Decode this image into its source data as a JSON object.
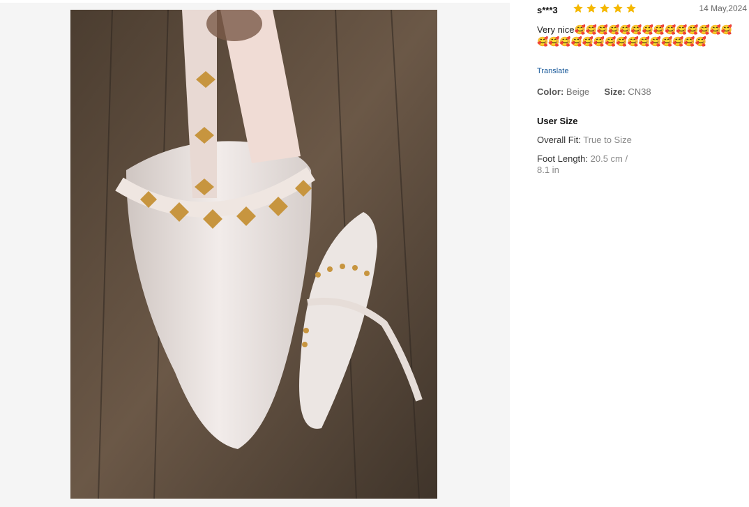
{
  "review": {
    "username": "s***3",
    "rating": 5,
    "date": "14 May,2024",
    "text": "Very nice🥰🥰🥰🥰🥰🥰🥰🥰🥰🥰🥰🥰🥰🥰🥰🥰🥰🥰🥰🥰🥰🥰🥰🥰🥰🥰🥰🥰🥰",
    "translate_label": "Translate",
    "color_label": "Color:",
    "color_value": "Beige",
    "size_label": "Size:",
    "size_value": "CN38",
    "user_size_title": "User Size",
    "fit_label": "Overall Fit:",
    "fit_value": "True to Size",
    "foot_label": "Foot Length:",
    "foot_value": "20.5 cm / 8.1 in"
  },
  "colors": {
    "star": "#f5b800",
    "link": "#1a5a9a",
    "panel_bg": "#f5f5f5"
  },
  "icons": {
    "star": "star-icon"
  }
}
